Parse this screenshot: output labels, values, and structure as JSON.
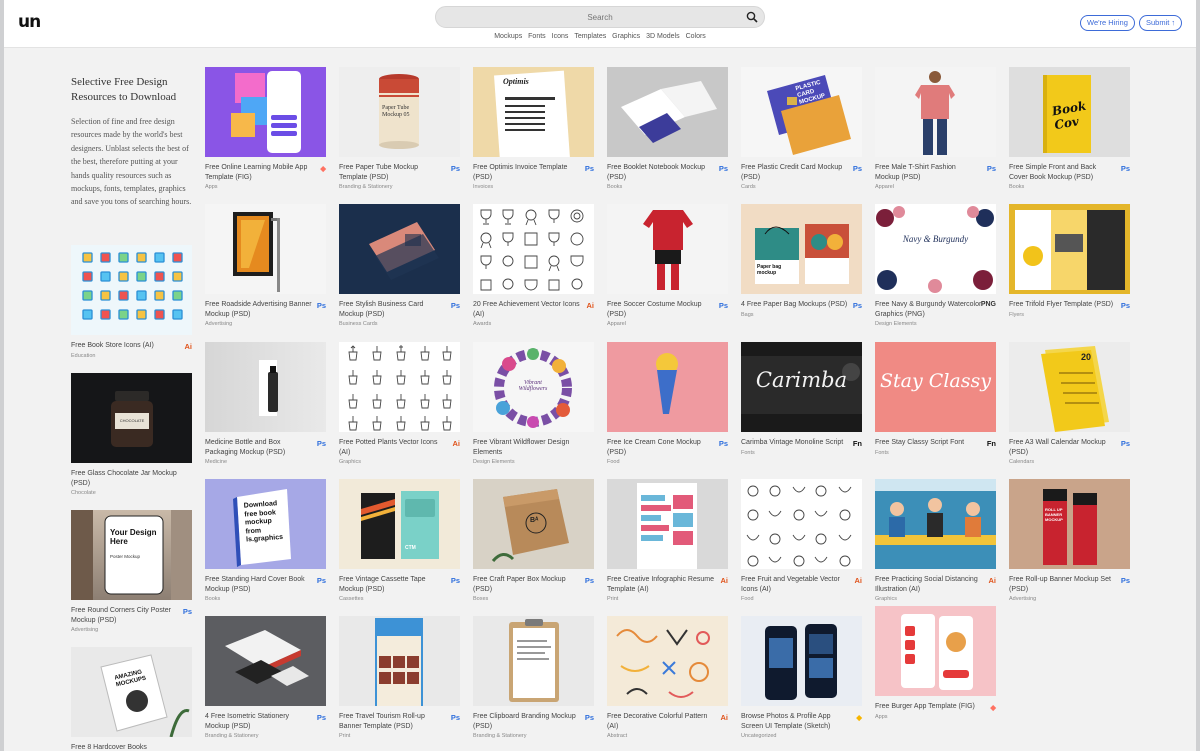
{
  "header": {
    "logo": "un",
    "search_placeholder": "Search",
    "nav": [
      "Mockups",
      "Fonts",
      "Icons",
      "Templates",
      "Graphics",
      "3D Models",
      "Colors"
    ],
    "hiring_label": "We're Hiring",
    "submit_label": "Submit ↑"
  },
  "sidebar": {
    "title": "Selective Free Design Resources to Download",
    "description": "Selection of fine and free design resources made by the world's best designers. Unblast selects the best of the best, therefore putting at your hands quality resources such as mockups, fonts, templates, graphics and save you tons of searching hours.",
    "cards": [
      {
        "title": "Free Book Store Icons (AI)",
        "category": "Education",
        "badge": "Ai",
        "type": "ai"
      },
      {
        "title": "Free Glass Chocolate Jar Mockup (PSD)",
        "category": "Chocolate",
        "badge": "",
        "type": ""
      },
      {
        "title": "Free Round Corners City Poster Mockup (PSD)",
        "category": "Advertising",
        "badge": "Ps",
        "type": "ps"
      },
      {
        "title": "Free 8 Hardcover Books",
        "category": "",
        "badge": "",
        "type": ""
      }
    ]
  },
  "columns": [
    [
      {
        "title": "Free Online Learning Mobile App Template (FIG)",
        "category": "Apps",
        "badge": "◆",
        "type": "fig"
      },
      {
        "title": "Free Roadside Advertising Banner Mockup (PSD)",
        "category": "Advertising",
        "badge": "Ps",
        "type": "ps"
      },
      {
        "title": "Medicine Bottle and Box Packaging Mockup (PSD)",
        "category": "Medicine",
        "badge": "Ps",
        "type": "ps"
      },
      {
        "title": "Free Standing Hard Cover Book Mockup (PSD)",
        "category": "Books",
        "badge": "Ps",
        "type": "ps"
      },
      {
        "title": "4 Free Isometric Stationery Mockup (PSD)",
        "category": "Branding & Stationery",
        "badge": "Ps",
        "type": "ps"
      }
    ],
    [
      {
        "title": "Free Paper Tube Mockup Template (PSD)",
        "category": "Branding & Stationery",
        "badge": "Ps",
        "type": "ps"
      },
      {
        "title": "Free Stylish Business Card Mockup (PSD)",
        "category": "Business Cards",
        "badge": "Ps",
        "type": "ps"
      },
      {
        "title": "Free Potted Plants Vector Icons (AI)",
        "category": "Graphics",
        "badge": "Ai",
        "type": "ai"
      },
      {
        "title": "Free Vintage Cassette Tape Mockup (PSD)",
        "category": "Cassettes",
        "badge": "Ps",
        "type": "ps"
      },
      {
        "title": "Free Travel Tourism Roll-up Banner Template (PSD)",
        "category": "Print",
        "badge": "Ps",
        "type": "ps"
      }
    ],
    [
      {
        "title": "Free Optimis Invoice Template (PSD)",
        "category": "Invoices",
        "badge": "Ps",
        "type": "ps"
      },
      {
        "title": "20 Free Achievement Vector Icons (AI)",
        "category": "Awards",
        "badge": "Ai",
        "type": "ai"
      },
      {
        "title": "Free Vibrant Wildflower Design Elements",
        "category": "Design Elements",
        "badge": "",
        "type": ""
      },
      {
        "title": "Free Craft Paper Box Mockup (PSD)",
        "category": "Boxes",
        "badge": "Ps",
        "type": "ps"
      },
      {
        "title": "Free Clipboard Branding Mockup (PSD)",
        "category": "Branding & Stationery",
        "badge": "Ps",
        "type": "ps"
      }
    ],
    [
      {
        "title": "Free Booklet Notebook Mockup (PSD)",
        "category": "Books",
        "badge": "Ps",
        "type": "ps"
      },
      {
        "title": "Free Soccer Costume Mockup (PSD)",
        "category": "Apparel",
        "badge": "Ps",
        "type": "ps"
      },
      {
        "title": "Free Ice Cream Cone Mockup (PSD)",
        "category": "Food",
        "badge": "Ps",
        "type": "ps"
      },
      {
        "title": "Free Creative Infographic Resume Template (AI)",
        "category": "Print",
        "badge": "Ai",
        "type": "ai"
      },
      {
        "title": "Free Decorative Colorful Pattern (AI)",
        "category": "Abstract",
        "badge": "Ai",
        "type": "ai"
      }
    ],
    [
      {
        "title": "Free Plastic Credit Card Mockup (PSD)",
        "category": "Cards",
        "badge": "Ps",
        "type": "ps"
      },
      {
        "title": "4 Free Paper Bag Mockups (PSD)",
        "category": "Bags",
        "badge": "Ps",
        "type": "ps"
      },
      {
        "title": "Carimba Vintage Monoline Script",
        "category": "Fonts",
        "badge": "Fn",
        "type": "fn"
      },
      {
        "title": "Free Fruit and Vegetable Vector Icons (AI)",
        "category": "Food",
        "badge": "Ai",
        "type": "ai"
      },
      {
        "title": "Browse Photos & Profile App Screen UI Template (Sketch)",
        "category": "Uncategorized",
        "badge": "◆",
        "type": "sk"
      }
    ],
    [
      {
        "title": "Free Male T-Shirt Fashion Mockup (PSD)",
        "category": "Apparel",
        "badge": "Ps",
        "type": "ps"
      },
      {
        "title": "Free Navy & Burgundy Watercolor Graphics (PNG)",
        "category": "Design Elements",
        "badge": "PNG",
        "type": "png"
      },
      {
        "title": "Free Stay Classy Script Font",
        "category": "Fonts",
        "badge": "Fn",
        "type": "fn"
      },
      {
        "title": "Free Practicing Social Distancing Illustration (AI)",
        "category": "Graphics",
        "badge": "Ai",
        "type": "ai"
      },
      {
        "title": "Free Burger App Template (FIG)",
        "category": "Apps",
        "badge": "◆",
        "type": "fig"
      }
    ],
    [
      {
        "title": "Free Simple Front and Back Cover Book Mockup (PSD)",
        "category": "Books",
        "badge": "Ps",
        "type": "ps"
      },
      {
        "title": "Free Trifold Flyer Template (PSD)",
        "category": "Flyers",
        "badge": "Ps",
        "type": "ps"
      },
      {
        "title": "Free A3 Wall Calendar Mockup (PSD)",
        "category": "Calendars",
        "badge": "Ps",
        "type": "ps"
      },
      {
        "title": "Free Roll-up Banner Mockup Set (PSD)",
        "category": "Advertising",
        "badge": "Ps",
        "type": "ps"
      }
    ]
  ],
  "thumb_text": {
    "paper_tube": "Paper Tube Mockup 05",
    "invoice_brand": "Optimis",
    "plastic_card": "PLASTIC CARD MOCKUP",
    "book_cover": "Book Cov",
    "business_card": "",
    "wildflower": "Vibrant Wildflowers",
    "carimba": "Carimba",
    "stay_classy": "Stay Classy",
    "calendar_num": "20",
    "hardcover": "Download free book mockup from ls.graphics",
    "craft_box": "Bᴬ",
    "cassette_label": "CTM",
    "roll_up": "ROLL UP BANNER MOCKUP",
    "city_poster": "Your Design Here",
    "city_poster_sub": "Poster Mockup",
    "chocolate": "CHOCOLATE",
    "amazing": "AMAZING MOCKUPS",
    "ice_cream": "",
    "paper_bag": "Paper bag mockup",
    "navy": "Navy & Burgundy"
  }
}
